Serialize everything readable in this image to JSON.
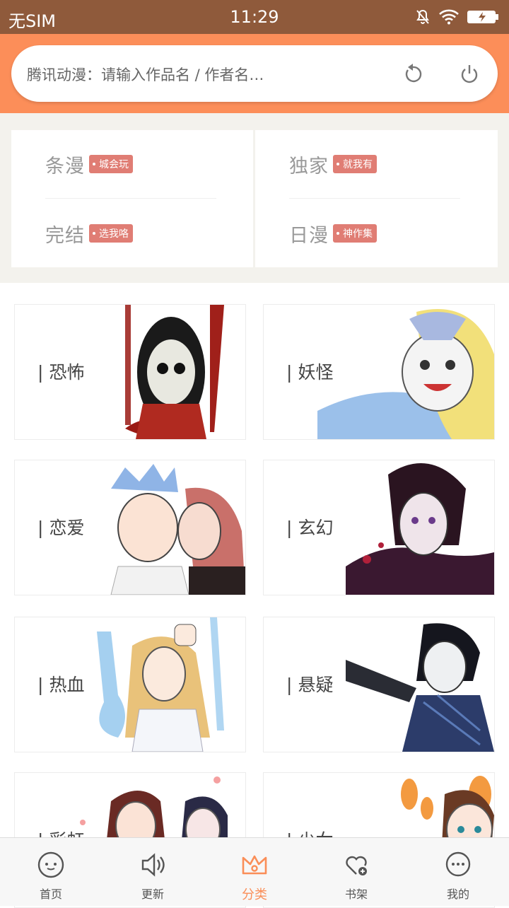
{
  "status": {
    "carrier": "无SIM",
    "time": "11:29"
  },
  "search": {
    "placeholder": "腾讯动漫：请输入作品名 / 作者名…"
  },
  "quick": {
    "items": [
      {
        "name": "条漫",
        "tag": "城会玩"
      },
      {
        "name": "完结",
        "tag": "选我咯"
      },
      {
        "name": "独家",
        "tag": "就我有"
      },
      {
        "name": "日漫",
        "tag": "神作集"
      }
    ]
  },
  "categories": [
    {
      "label": "恐怖"
    },
    {
      "label": "妖怪"
    },
    {
      "label": "恋爱"
    },
    {
      "label": "玄幻"
    },
    {
      "label": "热血"
    },
    {
      "label": "悬疑"
    },
    {
      "label": "彩虹"
    },
    {
      "label": "少女"
    }
  ],
  "tabs": [
    {
      "label": "首页",
      "icon": "face-icon"
    },
    {
      "label": "更新",
      "icon": "speaker-icon"
    },
    {
      "label": "分类",
      "icon": "crown-icon",
      "active": true
    },
    {
      "label": "书架",
      "icon": "heart-plus-icon"
    },
    {
      "label": "我的",
      "icon": "chat-bubble-icon"
    }
  ],
  "colors": {
    "status_bg": "#8f5a3b",
    "header_bg": "#fc8e59",
    "accent": "#fa8e58",
    "tag_bg": "#e07d74"
  }
}
